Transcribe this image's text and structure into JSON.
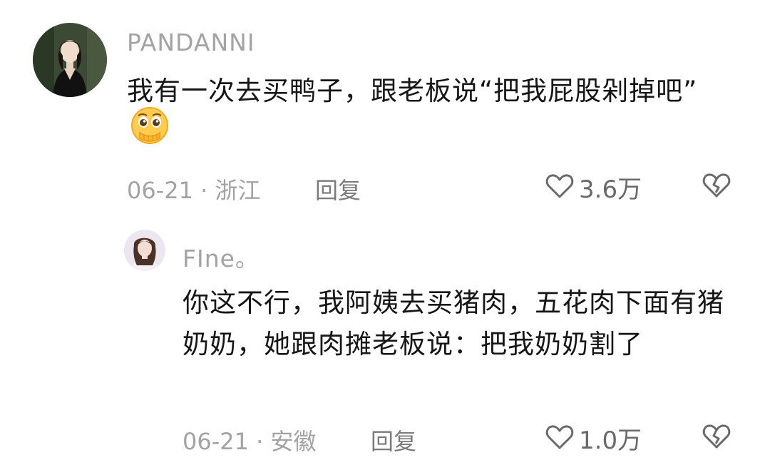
{
  "comments": [
    {
      "username": "PANDANNI",
      "text": "我有一次去买鸭子，跟老板说“把我屁股剁掉吧”",
      "emoji": "pleading-face-hand-over-mouth",
      "date": "06-21",
      "location": "浙江",
      "reply_label": "回复",
      "likes": "3.6万"
    },
    {
      "username": "FIne。",
      "text": "你这不行，我阿姨去买猪肉，五花肉下面有猪奶奶，她跟肉摊老板说：把我奶奶割了",
      "date": "06-21",
      "location": "安徽",
      "reply_label": "回复",
      "likes": "1.0万"
    }
  ],
  "meta_separator": "·",
  "icons": {
    "like": "heart-outline-icon",
    "dislike": "broken-heart-icon"
  },
  "colors": {
    "username": "#a3a3a3",
    "text": "#161616",
    "meta": "#a3a3a3",
    "reply": "#7a7a7a"
  }
}
